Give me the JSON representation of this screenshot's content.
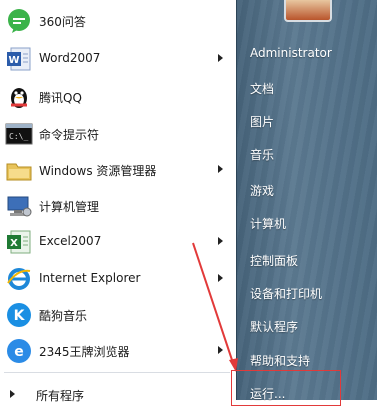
{
  "left_menu": {
    "items": [
      {
        "label": "360问答",
        "icon": "chat-bubble-icon",
        "arrow": false
      },
      {
        "label": "Word2007",
        "icon": "word-icon",
        "arrow": true
      },
      {
        "label": "腾讯QQ",
        "icon": "qq-penguin-icon",
        "arrow": false
      },
      {
        "label": "命令提示符",
        "icon": "command-prompt-icon",
        "arrow": false
      },
      {
        "label": "Windows 资源管理器",
        "icon": "folder-explorer-icon",
        "arrow": true
      },
      {
        "label": "计算机管理",
        "icon": "computer-management-icon",
        "arrow": false
      },
      {
        "label": "Excel2007",
        "icon": "excel-icon",
        "arrow": true
      },
      {
        "label": "Internet Explorer",
        "icon": "internet-explorer-icon",
        "arrow": true
      },
      {
        "label": "酷狗音乐",
        "icon": "kugou-music-icon",
        "arrow": false
      },
      {
        "label": "2345王牌浏览器",
        "icon": "browser-2345-icon",
        "arrow": true
      }
    ],
    "all_programs": "所有程序"
  },
  "right_menu": {
    "items": [
      "Administrator",
      "文档",
      "图片",
      "音乐",
      "游戏",
      "计算机",
      "控制面板",
      "设备和打印机",
      "默认程序",
      "帮助和支持",
      "运行..."
    ]
  },
  "annotation": {
    "color": "#e23a3a"
  }
}
